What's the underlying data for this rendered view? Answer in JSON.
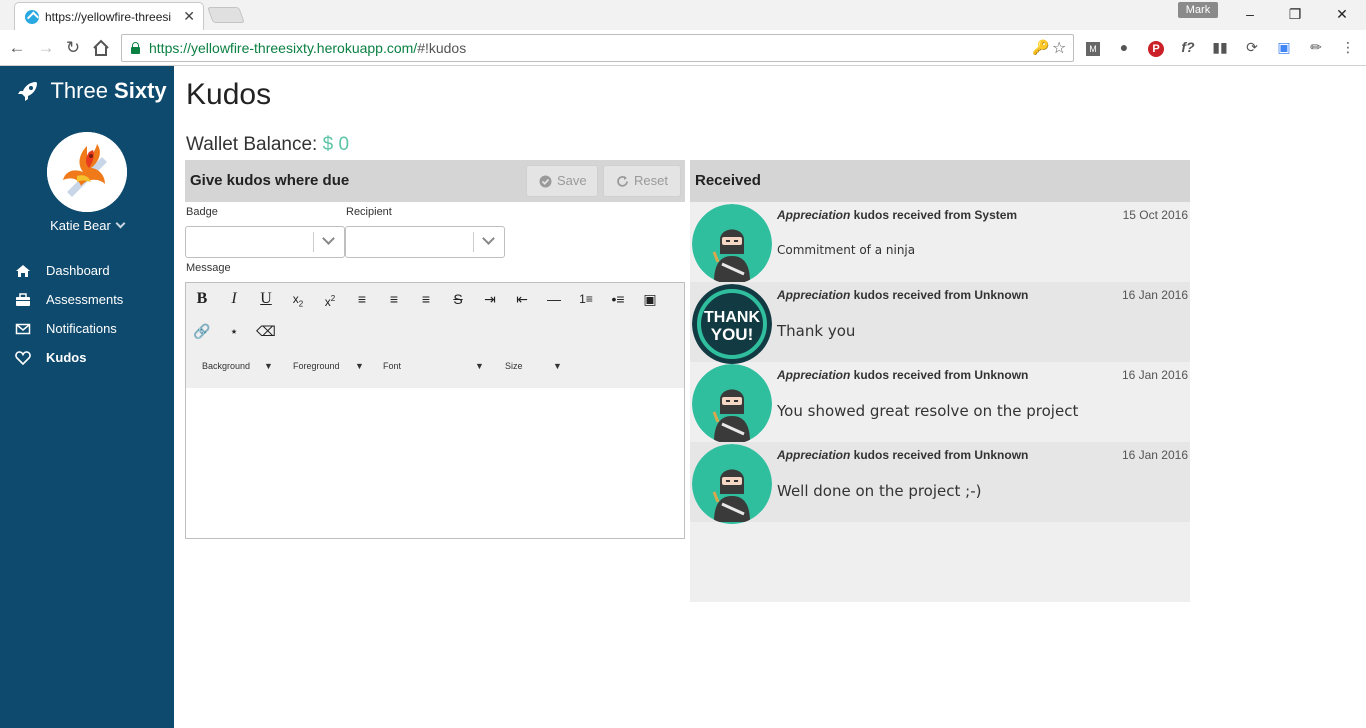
{
  "browser": {
    "tab_title": "https://yellowfire-threesi",
    "url_host": "https://yellowfire-threesixty.herokuapp.com/",
    "url_path": "#!kudos",
    "profile": "Mark"
  },
  "sidebar": {
    "brand_light": "Three ",
    "brand_bold": "Sixty",
    "user_name": "Katie Bear",
    "items": [
      {
        "label": "Dashboard",
        "icon": "home-icon"
      },
      {
        "label": "Assessments",
        "icon": "briefcase-icon"
      },
      {
        "label": "Notifications",
        "icon": "envelope-icon"
      },
      {
        "label": "Kudos",
        "icon": "heart-icon",
        "active": true
      }
    ]
  },
  "page": {
    "title": "Kudos",
    "wallet_label": "Wallet Balance:",
    "wallet_amount": "$ 0"
  },
  "give": {
    "title": "Give kudos where due",
    "save_label": "Save",
    "reset_label": "Reset",
    "badge_label": "Badge",
    "recipient_label": "Recipient",
    "message_label": "Message",
    "toolbar_selects": {
      "background": "Background",
      "foreground": "Foreground",
      "font": "Font",
      "size": "Size"
    }
  },
  "received": {
    "title": "Received",
    "items": [
      {
        "type": "Appreciation",
        "from_text": " kudos received from System",
        "date": "15 Oct 2016",
        "message": "Commitment of a ninja",
        "badge": "ninja"
      },
      {
        "type": "Appreciation",
        "from_text": " kudos received from Unknown",
        "date": "16 Jan 2016",
        "message": "Thank you",
        "badge": "thank-you"
      },
      {
        "type": "Appreciation",
        "from_text": " kudos received from Unknown",
        "date": "16 Jan 2016",
        "message": "You showed great resolve on the project",
        "badge": "ninja"
      },
      {
        "type": "Appreciation",
        "from_text": " kudos received from Unknown",
        "date": "16 Jan 2016",
        "message": "Well done on the project ;-)",
        "badge": "ninja"
      }
    ],
    "thank_you_line1": "THANK",
    "thank_you_line2": "YOU!"
  },
  "colors": {
    "sidebar": "#0e4a6e",
    "accent": "#5cc4a6",
    "badge_teal": "#2fbf9f"
  }
}
